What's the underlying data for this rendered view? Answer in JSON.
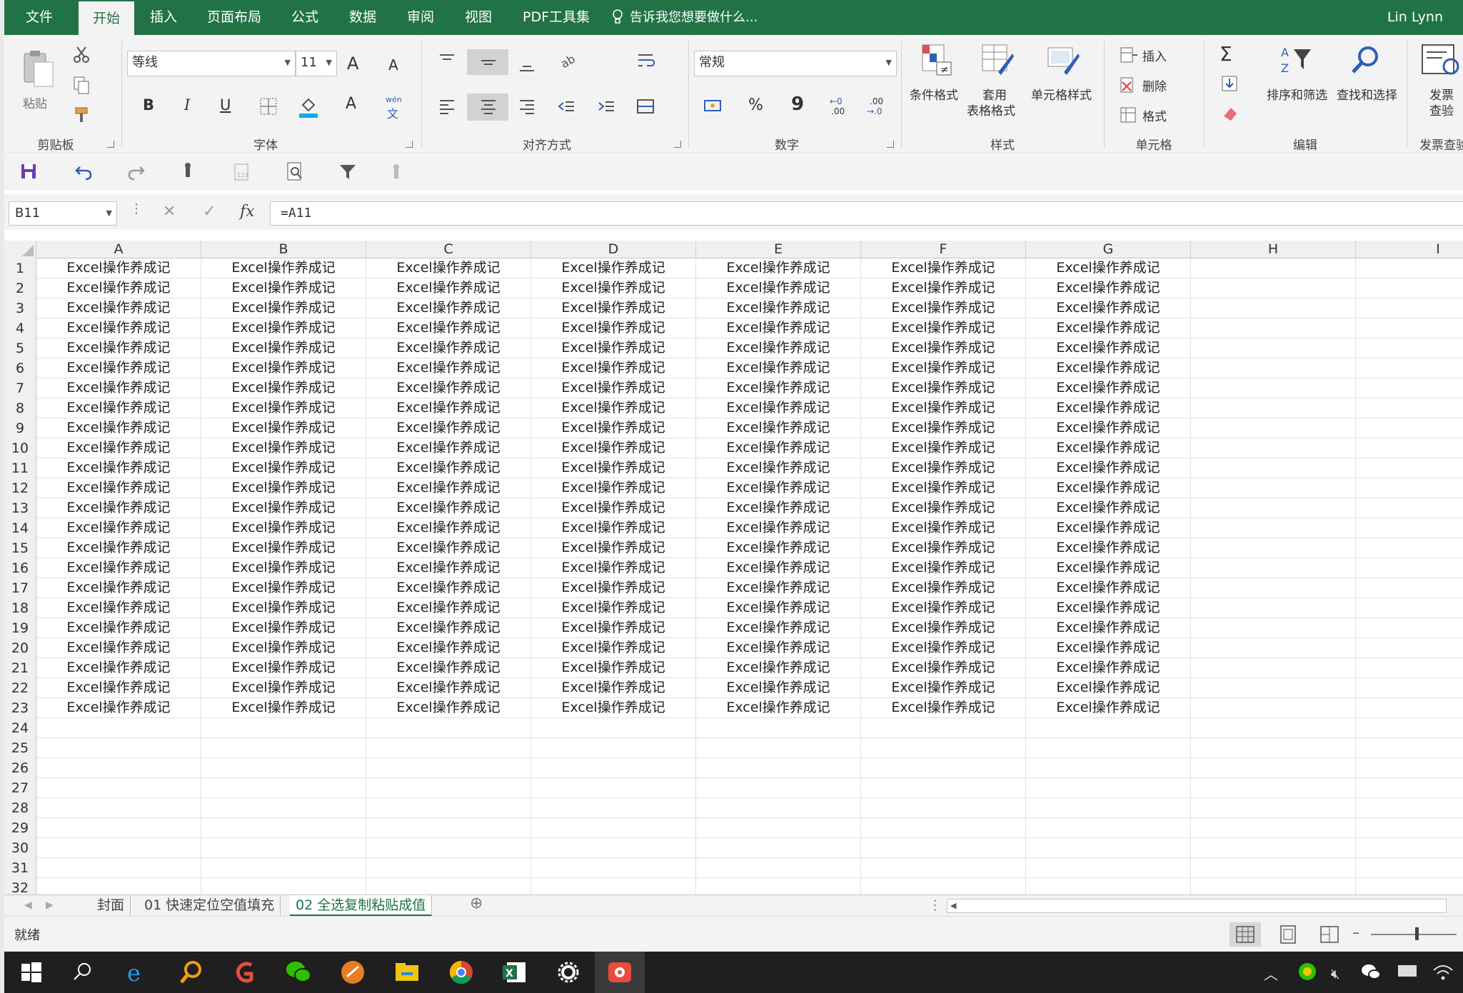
{
  "tabs": {
    "file": "文件",
    "home": "开始",
    "insert": "插入",
    "page_layout": "页面布局",
    "formulas": "公式",
    "data": "数据",
    "review": "审阅",
    "view": "视图",
    "pdf": "PDF工具集",
    "tell_me": "告诉我您想要做什么...",
    "user": "Lin Lynn"
  },
  "ribbon": {
    "clipboard": {
      "paste": "粘贴",
      "label": "剪贴板"
    },
    "font": {
      "name": "等线",
      "size": "11",
      "label": "字体",
      "bold": "B",
      "italic": "I",
      "underline": "U",
      "grow": "A",
      "shrink": "A",
      "color": "A",
      "phonetic_top": "wén",
      "phonetic_bottom": "文"
    },
    "alignment": {
      "label": "对齐方式"
    },
    "number": {
      "format": "常规",
      "label": "数字",
      "percent": "%",
      "comma": "9",
      "inc_top": "←0",
      "inc_bottom": ".00",
      "dec_top": ".00",
      "dec_bottom": "→.0"
    },
    "styles": {
      "conditional": "条件格式",
      "table_1": "套用",
      "table_2": "表格格式",
      "cell_styles": "单元格样式",
      "label": "样式"
    },
    "cells": {
      "insert": "插入",
      "delete": "删除",
      "format": "格式",
      "label": "单元格"
    },
    "editing": {
      "sigma": "Σ",
      "sort_filter": "排序和筛选",
      "find_select": "查找和选择",
      "label": "编辑"
    },
    "invoice": {
      "line1": "发票",
      "line2": "查验",
      "label": "发票查验"
    }
  },
  "formula_bar": {
    "name_box": "B11",
    "cancel": "✕",
    "enter": "✓",
    "fx": "fx",
    "formula": "=A11"
  },
  "columns": [
    "A",
    "B",
    "C",
    "D",
    "E",
    "F",
    "G",
    "H",
    "I"
  ],
  "rows": {
    "numbers": [
      "1",
      "2",
      "3",
      "4",
      "5",
      "6",
      "7",
      "8",
      "9",
      "10",
      "11",
      "12",
      "13",
      "14",
      "15",
      "16",
      "17",
      "18",
      "19",
      "20",
      "21",
      "22",
      "23",
      "24",
      "25",
      "26",
      "27",
      "28",
      "29",
      "30",
      "31",
      "32"
    ],
    "filled_rows": 23,
    "filled_cols": 7,
    "cell_text": "Excel操作养成记"
  },
  "sheets": {
    "tabs": [
      "封面",
      "01 快速定位空值填充",
      "02 全选复制粘贴成值"
    ],
    "active_index": 2,
    "add": "⊕"
  },
  "status": {
    "ready": "就绪"
  },
  "colors": {
    "accent": "#217346",
    "ribbon_bg": "#f3f3f3",
    "taskbar": "#1f1f1f"
  }
}
